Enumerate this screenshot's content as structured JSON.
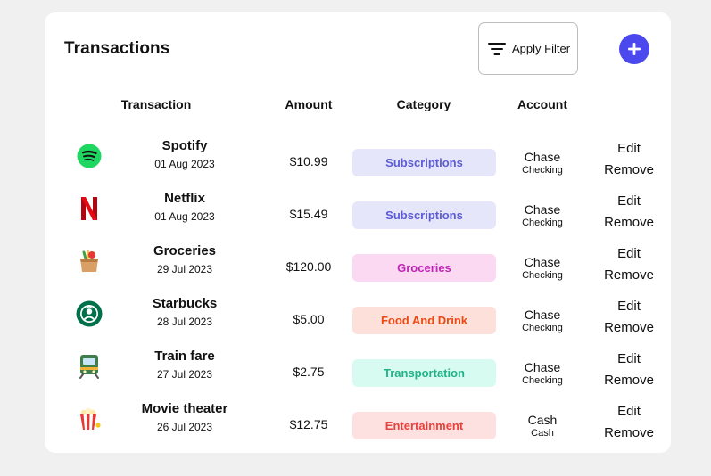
{
  "header": {
    "title": "Transactions",
    "filter_label": "Apply Filter",
    "add_icon": "plus-icon"
  },
  "columns": {
    "transaction": "Transaction",
    "amount": "Amount",
    "category": "Category",
    "account": "Account"
  },
  "actions": {
    "edit": "Edit",
    "remove": "Remove"
  },
  "colors": {
    "accent": "#4b48ee",
    "subscriptions_bg": "#e6e6fa",
    "subscriptions_fg": "#5c5cd6",
    "groceries_bg": "#fbd9f3",
    "groceries_fg": "#c026b5",
    "food_bg": "#fde0d9",
    "food_fg": "#ea4a14",
    "transport_bg": "#d8fbf1",
    "transport_fg": "#1fb386",
    "entertainment_bg": "#fde0e0",
    "entertainment_fg": "#e8413b"
  },
  "transactions": [
    {
      "icon": "spotify-icon",
      "name": "Spotify",
      "date": "01 Aug 2023",
      "amount": "$10.99",
      "category": "Subscriptions",
      "account": "Chase",
      "account_type": "Checking"
    },
    {
      "icon": "netflix-icon",
      "name": "Netflix",
      "date": "01 Aug 2023",
      "amount": "$15.49",
      "category": "Subscriptions",
      "account": "Chase",
      "account_type": "Checking"
    },
    {
      "icon": "grocery-bag-icon",
      "name": "Groceries",
      "date": "29 Jul 2023",
      "amount": "$120.00",
      "category": "Groceries",
      "account": "Chase",
      "account_type": "Checking"
    },
    {
      "icon": "starbucks-icon",
      "name": "Starbucks",
      "date": "28 Jul 2023",
      "amount": "$5.00",
      "category": "Food And Drink",
      "account": "Chase",
      "account_type": "Checking"
    },
    {
      "icon": "train-icon",
      "name": "Train fare",
      "date": "27 Jul 2023",
      "amount": "$2.75",
      "category": "Transportation",
      "account": "Chase",
      "account_type": "Checking"
    },
    {
      "icon": "popcorn-icon",
      "name": "Movie theater",
      "date": "26 Jul 2023",
      "amount": "$12.75",
      "category": "Entertainment",
      "account": "Cash",
      "account_type": "Cash"
    }
  ]
}
